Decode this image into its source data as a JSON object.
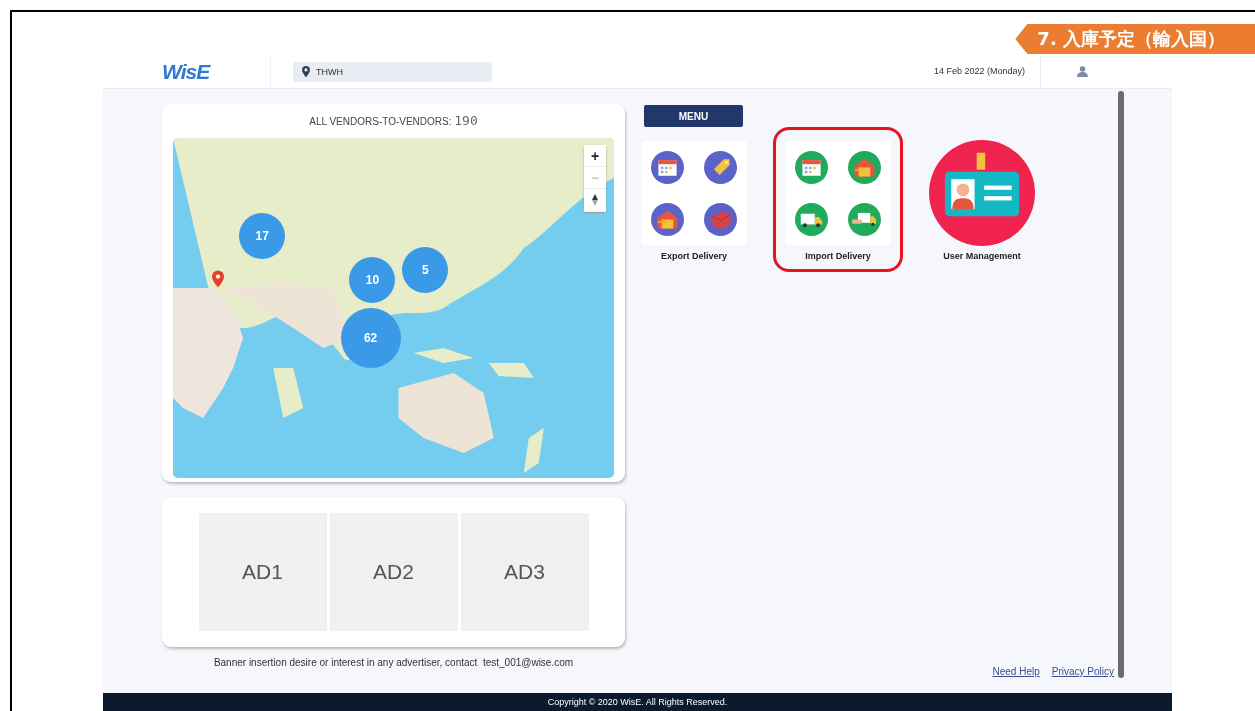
{
  "slide_tag": "7. 入庫予定（輸入国）",
  "header": {
    "logo": "WisE",
    "location": {
      "value": "THWH"
    },
    "date": "14 Feb 2022 (Monday)"
  },
  "map_card": {
    "title": "ALL VENDORS-TO-VENDORS:",
    "count": "190",
    "controls": [
      {
        "label": "+",
        "disabled": false
      },
      {
        "label": "−",
        "disabled": true
      }
    ],
    "clusters": [
      {
        "count": "17"
      },
      {
        "count": "10"
      },
      {
        "count": "5"
      },
      {
        "count": "62"
      }
    ]
  },
  "ads": [
    "AD1",
    "AD2",
    "AD3"
  ],
  "banner": {
    "text": "Banner insertion desire or interest in any advertiser, contact",
    "email": "test_001@wise.com"
  },
  "menu": {
    "title": "MENU",
    "items": [
      {
        "label": "Export Delivery",
        "kind": "grid",
        "color": "#5c63c8",
        "highlighted": false
      },
      {
        "label": "Import Delivery",
        "kind": "grid",
        "color": "#1faa5c",
        "highlighted": true
      },
      {
        "label": "User Management",
        "kind": "badge",
        "color": "#f0234f",
        "highlighted": false
      }
    ]
  },
  "footer_links": [
    "Need Help",
    "Privacy Policy"
  ],
  "copyright": "Copyright © 2020 WisE. All Rights Reserved."
}
